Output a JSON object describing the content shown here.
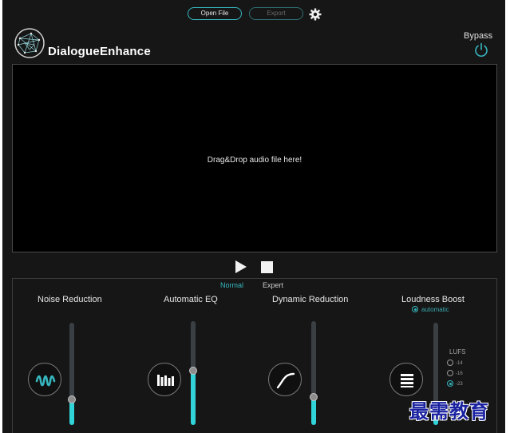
{
  "toolbar": {
    "open_file_label": "Open File",
    "export_label": "Export",
    "settings_icon": "gear-icon"
  },
  "header": {
    "app_title": "DialogueEnhance",
    "logo_icon": "network-globe-logo",
    "bypass_label": "Bypass",
    "bypass_icon": "power-icon"
  },
  "dropzone": {
    "text": "Drag&Drop audio file here!"
  },
  "transport": {
    "play_icon": "play-icon",
    "stop_icon": "stop-icon"
  },
  "modes": {
    "normal_label": "Normal",
    "expert_label": "Expert",
    "selected": "Normal"
  },
  "modules": {
    "noise": {
      "title": "Noise Reduction",
      "icon": "waveform-icon",
      "level": 0.25
    },
    "eq": {
      "title": "Automatic EQ",
      "icon": "equalizer-bars-icon",
      "level": 0.52
    },
    "dynamic": {
      "title": "Dynamic Reduction",
      "icon": "compressor-curve-icon",
      "level": 0.27
    },
    "loudness": {
      "title": "Loudness Boost",
      "icon": "loudness-bars-icon",
      "automatic_label": "automatic",
      "level": 0.1,
      "lufs_label": "LUFS",
      "lufs_options": [
        "-14",
        "-16",
        "-23"
      ],
      "lufs_selected": "-23"
    }
  },
  "colors": {
    "accent": "#36b7bf",
    "slider_fill": "#2fd3d8",
    "background": "#161616"
  },
  "watermark": "最需教育"
}
